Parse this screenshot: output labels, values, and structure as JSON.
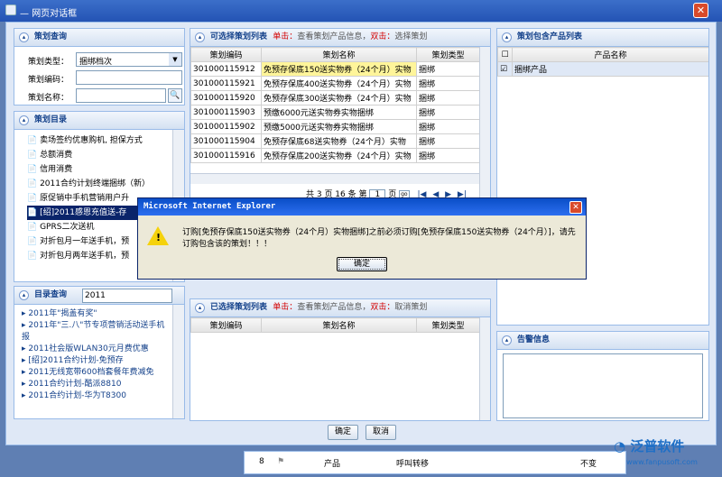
{
  "window": {
    "title": "网页对话框"
  },
  "left": {
    "search_panel": {
      "title": "策划查询",
      "type_label": "策划类型：",
      "type_value": "捆绑档次",
      "code_label": "策划编码：",
      "name_label": "策划名称："
    },
    "dir_panel": {
      "title": "策划目录",
      "items": [
        "卖场签约优惠购机, 担保方式",
        "总额消费",
        "信用消费",
        "2011合约计划终端捆绑（新）",
        "原促销中手机营销用户升",
        "[绍]2011感恩充值送-存",
        "GPRS二次送机",
        "对折包月一年送手机，预",
        "对折包月两年送手机，预"
      ]
    },
    "dirsearch_panel": {
      "title": "目录查询",
      "value": "2011",
      "items": [
        "2011年\"揭盖有奖\"",
        "2011年\"三.八\"节专项营销活动送手机报",
        "2011社会版WLAN30元月费优惠",
        "[绍]2011合约计划-免预存",
        "2011无线宽带600档套餐年费减免",
        "2011合约计划-酷派8810",
        "2011合约计划-华为T8300"
      ]
    }
  },
  "optional": {
    "title": "可选择策划列表",
    "hint1": "单击：",
    "hint1_text": "查看策划产品信息，",
    "hint2": "双击：",
    "hint2_text": "选择策划",
    "columns": [
      "策划编码",
      "策划名称",
      "策划类型"
    ],
    "rows": [
      [
        "301000115912",
        "免预存保底150送实物券（24个月）实物",
        "捆绑"
      ],
      [
        "301000115921",
        "免预存保底400送实物券（24个月）实物",
        "捆绑"
      ],
      [
        "301000115920",
        "免预存保底300送实物券（24个月）实物",
        "捆绑"
      ],
      [
        "301000115903",
        "预缴6000元送实物券实物捆绑",
        "捆绑"
      ],
      [
        "301000115902",
        "预缴5000元送实物券实物捆绑",
        "捆绑"
      ],
      [
        "301000115904",
        "免预存保底68送实物券（24个月）实物",
        "捆绑"
      ],
      [
        "301000115916",
        "免预存保底200送实物券（24个月）实物",
        "捆绑"
      ]
    ],
    "pager": {
      "total": "共 3 页 16 条 第",
      "page": "1",
      "unit": "页",
      "go": "go"
    }
  },
  "selected": {
    "title": "已选择策划列表",
    "hint1": "单击：",
    "hint1_text": "查看策划产品信息，",
    "hint2": "双击：",
    "hint2_text": "取消策划",
    "columns": [
      "策划编码",
      "策划名称",
      "策划类型"
    ]
  },
  "products": {
    "title": "策划包含产品列表",
    "column": "产品名称",
    "row": "捆绑产品"
  },
  "alarm": {
    "title": "告警信息"
  },
  "buttons": {
    "ok": "确定",
    "cancel": "取消"
  },
  "alert": {
    "title": "Microsoft Internet Explorer",
    "message": "订购[免预存保底150送实物券（24个月）实物捆绑]之前必须订购[免预存保底150送实物券（24个月）]，请先订购包含该的策划！！！",
    "ok": "确定"
  },
  "background": {
    "row_no": "8",
    "product": "产品",
    "transfer": "呼叫转移",
    "status": "不变"
  },
  "watermark": {
    "brand": "泛普软件",
    "url": "www.fanpusoft.com"
  }
}
